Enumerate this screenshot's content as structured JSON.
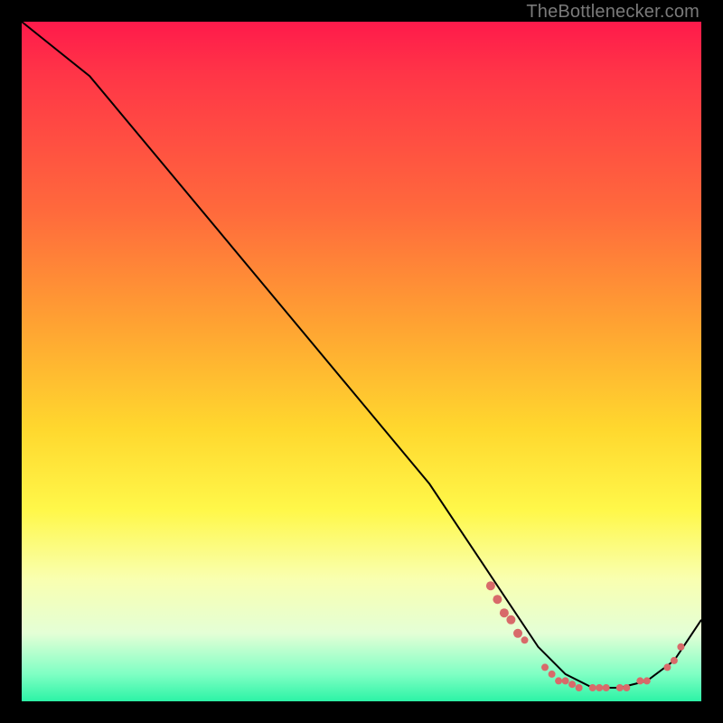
{
  "attribution": "TheBottlenecker.com",
  "colors": {
    "background": "#000000",
    "gradient_top": "#ff1a4b",
    "gradient_mid": "#ffd82e",
    "gradient_bottom": "#2cf3a6",
    "curve": "#000000",
    "marker": "#d86a6a"
  },
  "chart_data": {
    "type": "line",
    "title": "",
    "xlabel": "",
    "ylabel": "",
    "xlim": [
      0,
      100
    ],
    "ylim": [
      0,
      100
    ],
    "series": [
      {
        "name": "bottleneck-curve",
        "x": [
          0,
          5,
          10,
          20,
          30,
          40,
          50,
          60,
          68,
          72,
          76,
          80,
          84,
          88,
          92,
          96,
          100
        ],
        "y": [
          100,
          96,
          92,
          80,
          68,
          56,
          44,
          32,
          20,
          14,
          8,
          4,
          2,
          2,
          3,
          6,
          12
        ]
      }
    ],
    "markers": {
      "name": "highlighted-points",
      "points": [
        {
          "x": 69,
          "y": 17,
          "r": 5
        },
        {
          "x": 70,
          "y": 15,
          "r": 5
        },
        {
          "x": 71,
          "y": 13,
          "r": 5
        },
        {
          "x": 72,
          "y": 12,
          "r": 5
        },
        {
          "x": 73,
          "y": 10,
          "r": 5
        },
        {
          "x": 74,
          "y": 9,
          "r": 4
        },
        {
          "x": 77,
          "y": 5,
          "r": 4
        },
        {
          "x": 78,
          "y": 4,
          "r": 4
        },
        {
          "x": 79,
          "y": 3,
          "r": 4
        },
        {
          "x": 80,
          "y": 3,
          "r": 4
        },
        {
          "x": 81,
          "y": 2.5,
          "r": 4
        },
        {
          "x": 82,
          "y": 2,
          "r": 4
        },
        {
          "x": 84,
          "y": 2,
          "r": 4
        },
        {
          "x": 85,
          "y": 2,
          "r": 4
        },
        {
          "x": 86,
          "y": 2,
          "r": 4
        },
        {
          "x": 88,
          "y": 2,
          "r": 4
        },
        {
          "x": 89,
          "y": 2,
          "r": 4
        },
        {
          "x": 91,
          "y": 3,
          "r": 4
        },
        {
          "x": 92,
          "y": 3,
          "r": 4
        },
        {
          "x": 95,
          "y": 5,
          "r": 4
        },
        {
          "x": 96,
          "y": 6,
          "r": 4
        },
        {
          "x": 97,
          "y": 8,
          "r": 4
        }
      ]
    }
  }
}
